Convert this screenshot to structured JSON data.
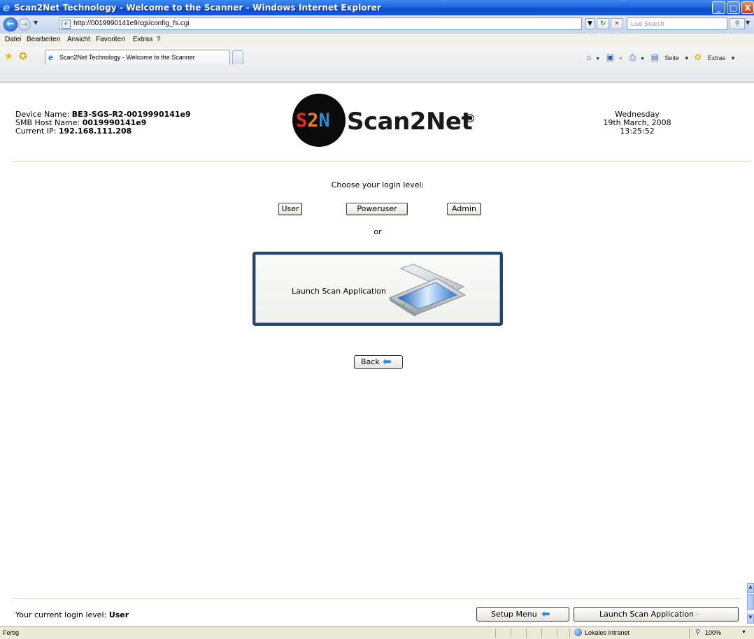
{
  "window": {
    "title": "Scan2Net Technology - Welcome to the Scanner - Windows Internet Explorer",
    "min_glyph": "_",
    "max_glyph": "□",
    "close_glyph": "X"
  },
  "address_bar": {
    "url": "http://0019990141e9/cgi/config_fs.cgi",
    "search_placeholder": "Live Search"
  },
  "menu": [
    "Datei",
    "Bearbeiten",
    "Ansicht",
    "Favoriten",
    "Extras",
    "?"
  ],
  "tab": {
    "label": "Scan2Net Technology - Welcome to the Scanner"
  },
  "command_bar": {
    "page_label": "Seite",
    "extras_label": "Extras"
  },
  "device": {
    "name_label": "Device Name:",
    "name_value": "BE3-SGS-R2-0019990141e9",
    "smb_label": "SMB Host Name:",
    "smb_value": "0019990141e9",
    "ip_label": "Current IP:",
    "ip_value": "192.168.111.208"
  },
  "logo": {
    "mark": "S2N",
    "wordmark": "Scan2Net",
    "registered": "®"
  },
  "datetime": {
    "weekday": "Wednesday",
    "date": "19th March, 2008",
    "time": "13:25:52"
  },
  "login": {
    "prompt": "Choose your login level:",
    "levels": [
      "User",
      "Poweruser",
      "Admin"
    ],
    "or": "or"
  },
  "launch_panel": {
    "label": "Launch Scan Application"
  },
  "back_label": "Back",
  "footer": {
    "status_label": "Your current login level:",
    "status_value": "User",
    "setup_label": "Setup Menu",
    "launch_label": "Launch Scan Application"
  },
  "statusbar": {
    "text": "Fertig",
    "zone": "Lokales Intranet",
    "zoom": "100%"
  },
  "colors": {
    "titlebar": "#1458d6",
    "panel_border": "#22466d",
    "accent_arrow": "#1f8fe0",
    "logo_red": "#e8262b",
    "logo_orange": "#f07a1e",
    "logo_blue": "#2b8bd6"
  }
}
